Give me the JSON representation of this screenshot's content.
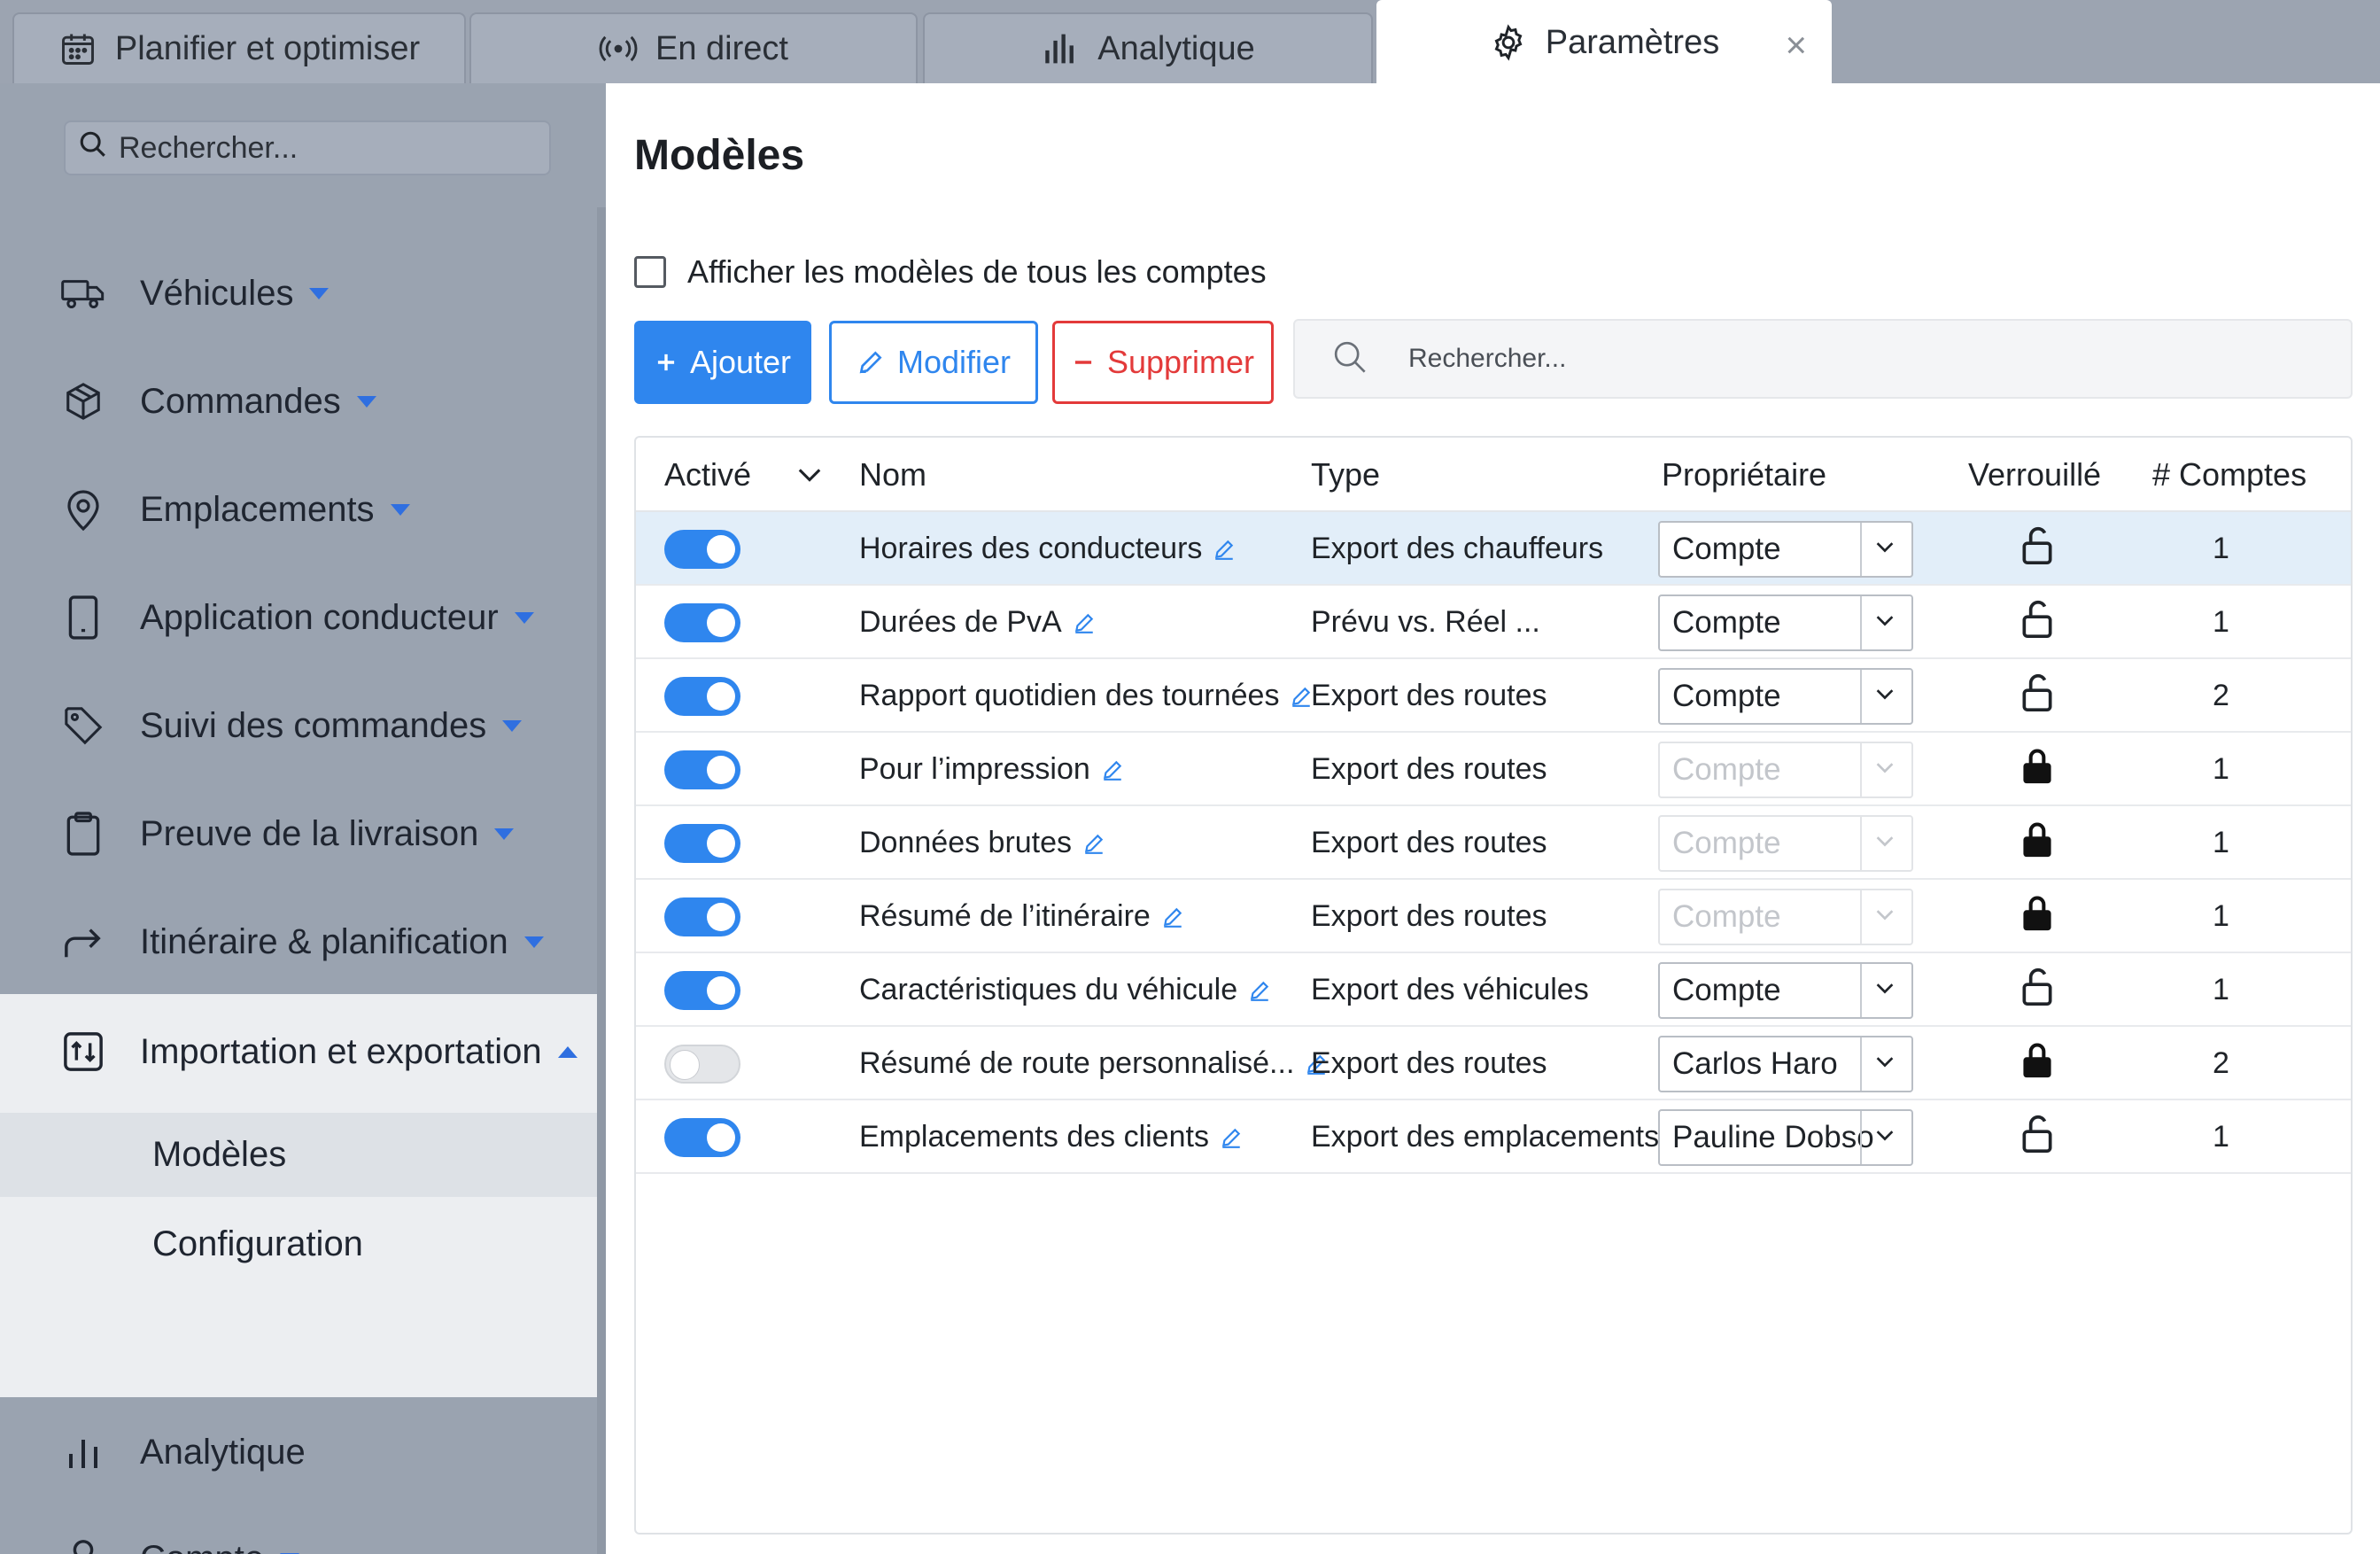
{
  "tabs": [
    {
      "label": "Planifier et optimiser",
      "icon": "calendar-icon"
    },
    {
      "label": "En direct",
      "icon": "broadcast-icon"
    },
    {
      "label": "Analytique",
      "icon": "bar-chart-icon"
    },
    {
      "label": "Paramètres",
      "icon": "gear-icon",
      "active": true
    }
  ],
  "tab_close": "×",
  "sidebar": {
    "search_placeholder": "Rechercher...",
    "items": [
      {
        "label": "Véhicules",
        "icon": "truck-icon"
      },
      {
        "label": "Commandes",
        "icon": "box-icon"
      },
      {
        "label": "Emplacements",
        "icon": "map-pin-icon"
      },
      {
        "label": "Application conducteur",
        "icon": "phone-icon"
      },
      {
        "label": "Suivi des commandes",
        "icon": "tag-icon"
      },
      {
        "label": "Preuve de la livraison",
        "icon": "clipboard-icon"
      },
      {
        "label": "Itinéraire & planification",
        "icon": "redirect-arrow-icon"
      },
      {
        "label": "Importation et exportation",
        "icon": "import-export-icon",
        "expanded": true
      },
      {
        "label": "Analytique",
        "icon": "bar-chart-icon"
      },
      {
        "label": "Compte",
        "icon": "user-icon"
      }
    ],
    "subitems": [
      {
        "label": "Modèles",
        "selected": true
      },
      {
        "label": "Configuration"
      }
    ]
  },
  "main": {
    "title": "Modèles",
    "show_all_label": "Afficher les modèles de tous les comptes",
    "add_label": "Ajouter",
    "edit_label": "Modifier",
    "delete_label": "Supprimer",
    "search_placeholder": "Rechercher...",
    "columns": {
      "active": "Activé",
      "name": "Nom",
      "type": "Type",
      "owner": "Propriétaire",
      "locked": "Verrouillé",
      "accounts": "# Comptes"
    },
    "rows": [
      {
        "active": true,
        "name": "Horaires des conducteurs",
        "type": "Export des chauffeurs",
        "owner": "Compte",
        "owner_enabled": true,
        "locked": false,
        "accounts": "1"
      },
      {
        "active": true,
        "name": "Durées de PvA",
        "type": "Prévu vs. Réel ...",
        "owner": "Compte",
        "owner_enabled": true,
        "locked": false,
        "accounts": "1"
      },
      {
        "active": true,
        "name": "Rapport quotidien des tournées",
        "type": "Export des routes",
        "owner": "Compte",
        "owner_enabled": true,
        "locked": false,
        "accounts": "2"
      },
      {
        "active": true,
        "name": "Pour l’impression",
        "type": "Export des routes",
        "owner": "Compte",
        "owner_enabled": false,
        "locked": true,
        "accounts": "1"
      },
      {
        "active": true,
        "name": "Données brutes",
        "type": "Export des routes",
        "owner": "Compte",
        "owner_enabled": false,
        "locked": true,
        "accounts": "1"
      },
      {
        "active": true,
        "name": "Résumé de l’itinéraire",
        "type": "Export des routes",
        "owner": "Compte",
        "owner_enabled": false,
        "locked": true,
        "accounts": "1"
      },
      {
        "active": true,
        "name": "Caractéristiques du véhicule",
        "type": "Export des véhicules",
        "owner": "Compte",
        "owner_enabled": true,
        "locked": false,
        "accounts": "1"
      },
      {
        "active": false,
        "name": "Résumé de route personnalisé...",
        "type": "Export des routes",
        "owner": "Carlos Haro",
        "owner_enabled": true,
        "locked": true,
        "accounts": "2"
      },
      {
        "active": true,
        "name": "Emplacements des clients",
        "type": "Export des emplacements",
        "owner": "Pauline Dobso",
        "owner_enabled": true,
        "locked": false,
        "accounts": "1"
      }
    ]
  },
  "colors": {
    "accent": "#2f86ee",
    "danger": "#e33a3a",
    "sidebar_bg": "#9aa3b0"
  }
}
